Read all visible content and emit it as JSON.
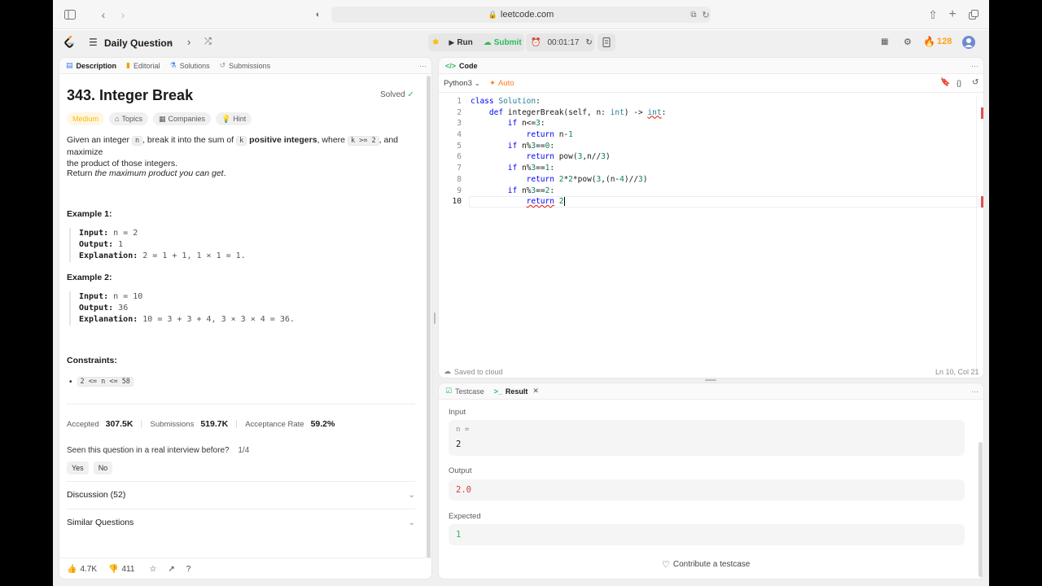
{
  "browser": {
    "url": "leetcode.com"
  },
  "nav": {
    "title": "Daily Question",
    "run": "Run",
    "submit": "Submit",
    "timer": "00:01:17",
    "streak": "128"
  },
  "left_tabs": [
    {
      "label": "Description"
    },
    {
      "label": "Editorial"
    },
    {
      "label": "Solutions"
    },
    {
      "label": "Submissions"
    }
  ],
  "problem": {
    "title": "343. Integer Break",
    "status": "Solved",
    "difficulty": "Medium",
    "chips": [
      "Topics",
      "Companies",
      "Hint"
    ],
    "desc_a": "Given an integer ",
    "desc_n": "n",
    "desc_b": ", break it into the sum of ",
    "desc_k": "k",
    "desc_bold": "positive integers",
    "desc_c": ", where ",
    "desc_k2": "k >= 2",
    "desc_d": ", and maximize",
    "desc_line2": "the product of those integers.",
    "ret_a": "Return ",
    "ret_em": "the maximum product you can get",
    "ret_b": ".",
    "ex1_title": "Example 1:",
    "ex1_input_k": "Input:",
    "ex1_input_v": " n = 2",
    "ex1_output_k": "Output:",
    "ex1_output_v": " 1",
    "ex1_expl_k": "Explanation:",
    "ex1_expl_v": " 2 = 1 + 1, 1 × 1 = 1.",
    "ex2_title": "Example 2:",
    "ex2_input_k": "Input:",
    "ex2_input_v": " n = 10",
    "ex2_output_k": "Output:",
    "ex2_output_v": " 36",
    "ex2_expl_k": "Explanation:",
    "ex2_expl_v": " 10 = 3 + 3 + 4, 3 × 3 × 4 = 36.",
    "constraints_title": "Constraints:",
    "constraint": "2 <= n <= 58",
    "accepted_label": "Accepted",
    "accepted_val": "307.5K",
    "submissions_label": "Submissions",
    "submissions_val": "519.7K",
    "rate_label": "Acceptance Rate",
    "rate_val": "59.2%",
    "interview_q": "Seen this question in a real interview before?",
    "interview_count": "1/4",
    "yes": "Yes",
    "no": "No",
    "discussion": "Discussion (52)",
    "similar": "Similar Questions",
    "likes": "4.7K",
    "dislikes": "411"
  },
  "code": {
    "tab": "Code",
    "language": "Python3",
    "auto": "Auto",
    "saved": "Saved to cloud",
    "cursor": "Ln 10, Col 21"
  },
  "result": {
    "tab_testcase": "Testcase",
    "tab_result": "Result",
    "input_label": "Input",
    "input_var": "n =",
    "input_val": "2",
    "output_label": "Output",
    "output_val": "2.0",
    "expected_label": "Expected",
    "expected_val": "1",
    "contribute": "Contribute a testcase"
  }
}
